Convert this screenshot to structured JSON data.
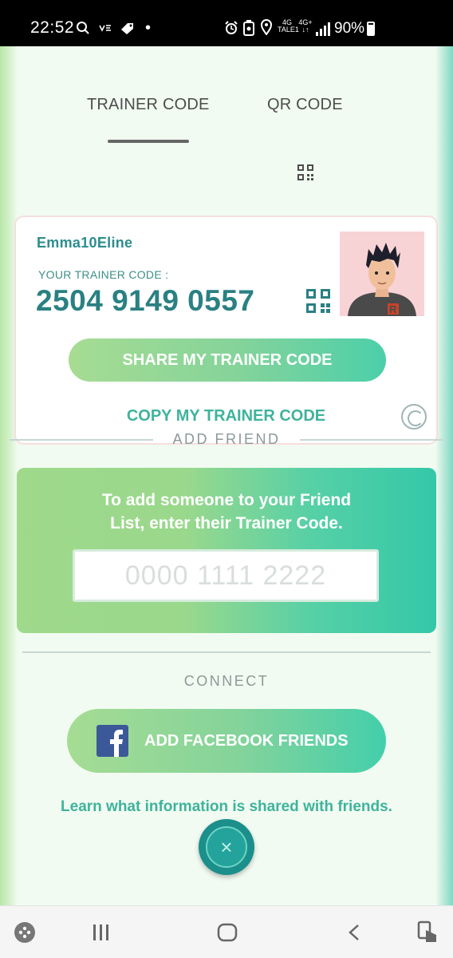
{
  "status_bar": {
    "time": "22:52",
    "battery": "90%",
    "network_top": "4G",
    "network_bottom": "TALE1",
    "network2_top": "4G+",
    "network2_bottom": "↓↑"
  },
  "tabs": [
    {
      "label": "TRAINER CODE",
      "active": true
    },
    {
      "label": "QR CODE",
      "active": false
    }
  ],
  "profile": {
    "username": "Emma10Eline",
    "code_label": "YOUR TRAINER CODE :",
    "trainer_code": "2504 9149 0557",
    "share_label": "SHARE MY TRAINER CODE",
    "copy_label": "COPY MY TRAINER CODE"
  },
  "add_friend": {
    "section_title": "ADD FRIEND",
    "instruction_line1": "To add someone to your Friend",
    "instruction_line2": "List, enter their Trainer Code.",
    "input_placeholder": "0000 1111 2222",
    "input_value": ""
  },
  "connect": {
    "section_title": "CONNECT",
    "facebook_label": "ADD FACEBOOK FRIENDS",
    "learn_link": "Learn what information is shared with friends."
  },
  "close_label": "×",
  "nav_icons": [
    "game-launcher-icon",
    "recent-apps-icon",
    "home-icon",
    "back-icon",
    "screenshot-edit-icon"
  ],
  "colors": {
    "accent_teal": "#2a8082",
    "link_green": "#3fb39c",
    "facebook_blue": "#3b5998",
    "avatar_bg": "#f8d3d6"
  }
}
